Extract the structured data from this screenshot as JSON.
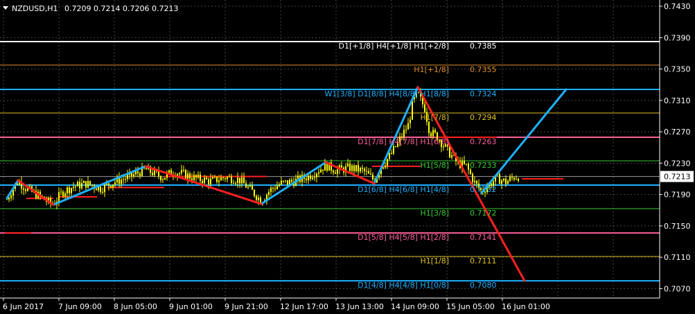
{
  "header": {
    "symbol": "NZDUSD,H1",
    "ohlc": "0.7209 0.7214 0.7206 0.7213"
  },
  "current_price_label": "0.7213",
  "colors": {
    "background": "#000000",
    "grid": "#808080",
    "candles": "#ffff00",
    "up_trend": "#1fb0ff",
    "down_trend": "#ff2020",
    "level_white": "#ffffff",
    "level_orange": "#e0902a",
    "level_cyan": "#1fb0ff",
    "level_yellow": "#e0c020",
    "level_pink": "#ff5f9a",
    "level_green": "#33cc33",
    "level_red": "#ff2020"
  },
  "chart_data": {
    "type": "candlestick",
    "symbol": "NZDUSD",
    "timeframe": "H1",
    "ylim": [
      0.7058,
      0.7438
    ],
    "xlim": [
      0,
      999
    ],
    "yticks": [
      "0.7430",
      "0.7390",
      "0.7350",
      "0.7310",
      "0.7270",
      "0.7230",
      "0.7190",
      "0.7150",
      "0.7110",
      "0.7070"
    ],
    "xticks": [
      {
        "label": "6 Jun 2017",
        "x": 0
      },
      {
        "label": "7 Jun 09:00",
        "x": 80
      },
      {
        "label": "8 Jun 05:00",
        "x": 160
      },
      {
        "label": "9 Jun 01:00",
        "x": 240
      },
      {
        "label": "9 Jun 21:00",
        "x": 320
      },
      {
        "label": "12 Jun 17:00",
        "x": 400
      },
      {
        "label": "13 Jun 13:00",
        "x": 480
      },
      {
        "label": "14 Jun 09:00",
        "x": 560
      },
      {
        "label": "15 Jun 05:00",
        "x": 640
      },
      {
        "label": "16 Jun 01:00",
        "x": 720
      }
    ],
    "current_price": 0.7213,
    "murray_levels": [
      {
        "label": "D1[+1/8] H4[+1/8] H1[+2/8]",
        "value": "0.7385",
        "y": 0.7385,
        "color": "#ffffff"
      },
      {
        "label": "H1[+1/8]",
        "value": "0.7355",
        "y": 0.7355,
        "color": "#e0902a"
      },
      {
        "label": "W1[3/8] D1[8/8] H4[8/8] H1[8/8]",
        "value": "0.7324",
        "y": 0.7324,
        "color": "#1fb0ff"
      },
      {
        "label": "H1[7/8]",
        "value": "0.7294",
        "y": 0.7294,
        "color": "#e0c020"
      },
      {
        "label": "D1[7/8] H4[7/8] H1[6/8]",
        "value": "0.7263",
        "y": 0.7263,
        "color": "#ff5f9a"
      },
      {
        "label": "H1[5/8]",
        "value": "0.7233",
        "y": 0.7233,
        "color": "#33cc33"
      },
      {
        "label": "D1[6/8] H4[6/8] H1[4/8]",
        "value": "0.7202",
        "y": 0.7202,
        "color": "#1fb0ff"
      },
      {
        "label": "H1[3/8]",
        "value": "0.7172",
        "y": 0.7172,
        "color": "#33cc33"
      },
      {
        "label": "D1[5/8] H4[5/8] H1[2/8]",
        "value": "0.7141",
        "y": 0.7141,
        "color": "#ff5f9a"
      },
      {
        "label": "H1[1/8]",
        "value": "0.7111",
        "y": 0.7111,
        "color": "#e0c020"
      },
      {
        "label": "D1[4/8] H4[4/8] H1[0/8]",
        "value": "0.7080",
        "y": 0.708,
        "color": "#1fb0ff"
      }
    ],
    "zigzag_up": [
      [
        [
          5,
          0.7185
        ],
        [
          21,
          0.7208
        ]
      ],
      [
        [
          72,
          0.7177
        ],
        [
          205,
          0.7226
        ]
      ],
      [
        [
          372,
          0.7178
        ],
        [
          465,
          0.7231
        ]
      ],
      [
        [
          535,
          0.7204
        ],
        [
          598,
          0.7327
        ]
      ],
      [
        [
          690,
          0.7192
        ],
        [
          812,
          0.7324
        ]
      ]
    ],
    "zigzag_down": [
      [
        [
          21,
          0.7208
        ],
        [
          72,
          0.7177
        ]
      ],
      [
        [
          205,
          0.7226
        ],
        [
          372,
          0.7178
        ]
      ],
      [
        [
          465,
          0.7231
        ],
        [
          535,
          0.7204
        ]
      ],
      [
        [
          598,
          0.7327
        ],
        [
          752,
          0.708
        ]
      ]
    ],
    "horizontal_segments": [
      [
        2,
        40,
        0.7141
      ],
      [
        33,
        72,
        0.7185
      ],
      [
        80,
        135,
        0.7187
      ],
      [
        150,
        232,
        0.7199
      ],
      [
        232,
        380,
        0.7213
      ],
      [
        532,
        602,
        0.7226
      ],
      [
        627,
        712,
        0.7263
      ],
      [
        748,
        808,
        0.721
      ]
    ],
    "price_path": [
      [
        5,
        0.7184
      ],
      [
        15,
        0.72
      ],
      [
        21,
        0.7207
      ],
      [
        35,
        0.7196
      ],
      [
        50,
        0.7189
      ],
      [
        65,
        0.718
      ],
      [
        72,
        0.7178
      ],
      [
        85,
        0.7193
      ],
      [
        100,
        0.72
      ],
      [
        120,
        0.7204
      ],
      [
        140,
        0.7198
      ],
      [
        160,
        0.7206
      ],
      [
        180,
        0.7212
      ],
      [
        205,
        0.7222
      ],
      [
        215,
        0.7218
      ],
      [
        230,
        0.7212
      ],
      [
        245,
        0.7219
      ],
      [
        260,
        0.7216
      ],
      [
        280,
        0.721
      ],
      [
        300,
        0.7207
      ],
      [
        320,
        0.7212
      ],
      [
        340,
        0.7209
      ],
      [
        360,
        0.7193
      ],
      [
        372,
        0.7182
      ],
      [
        385,
        0.7196
      ],
      [
        400,
        0.7204
      ],
      [
        420,
        0.7207
      ],
      [
        440,
        0.7213
      ],
      [
        465,
        0.7227
      ],
      [
        480,
        0.7221
      ],
      [
        500,
        0.7224
      ],
      [
        520,
        0.722
      ],
      [
        535,
        0.7208
      ],
      [
        545,
        0.7225
      ],
      [
        560,
        0.7242
      ],
      [
        575,
        0.7265
      ],
      [
        585,
        0.728
      ],
      [
        590,
        0.7306
      ],
      [
        598,
        0.7318
      ],
      [
        608,
        0.73
      ],
      [
        615,
        0.727
      ],
      [
        625,
        0.7265
      ],
      [
        640,
        0.7247
      ],
      [
        655,
        0.723
      ],
      [
        668,
        0.7226
      ],
      [
        680,
        0.7205
      ],
      [
        690,
        0.7194
      ],
      [
        700,
        0.7202
      ],
      [
        712,
        0.7211
      ],
      [
        725,
        0.7206
      ],
      [
        738,
        0.7213
      ],
      [
        745,
        0.7213
      ]
    ]
  }
}
